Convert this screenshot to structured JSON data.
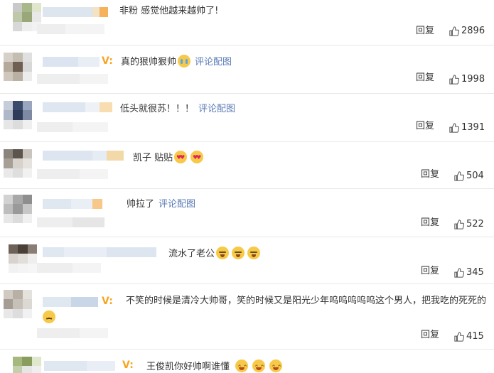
{
  "reply_label": "回复",
  "link_label": "评论配图",
  "comments": [
    {
      "text": "非粉 感觉他越来越帅了!",
      "likes": "2896"
    },
    {
      "text": "真的狠帅狠帅",
      "likes": "1998"
    },
    {
      "text": "低头就很苏！！！",
      "likes": "1391"
    },
    {
      "text": "凯子 贴贴",
      "likes": "504"
    },
    {
      "text": "帅拉了",
      "likes": "522"
    },
    {
      "text": "流水了老公",
      "likes": "345"
    },
    {
      "text": "不笑的时候是清冷大帅哥，笑的时候又是阳光少年呜呜呜呜呜这个男人，把我吃的死死的",
      "likes": "415"
    },
    {
      "text": "王俊凯你好帅啊谁懂"
    }
  ],
  "verified_badge": "V:",
  "icons": {
    "like": "thumbs-up-icon",
    "verified": "verified-v-icon"
  },
  "colors": {
    "link": "#5a7bb5",
    "badge": "#f5a623",
    "text": "#333333",
    "divider": "#e8e8e8"
  }
}
